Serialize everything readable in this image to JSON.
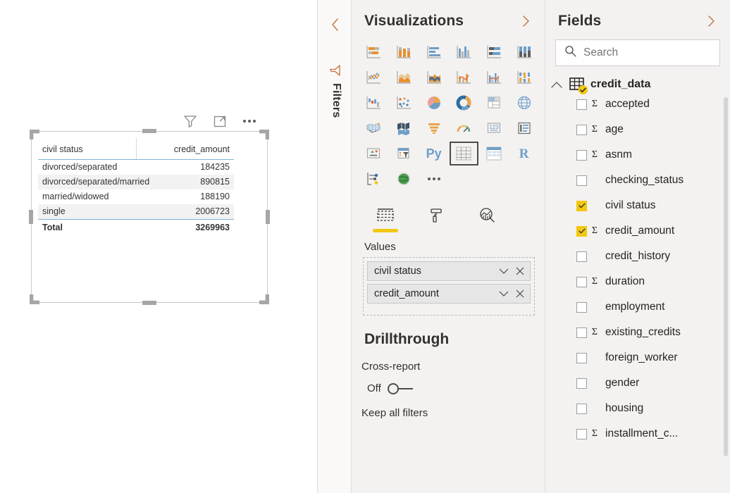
{
  "canvas": {
    "toolbar": [
      {
        "name": "filter-icon",
        "label": "Filters"
      },
      {
        "name": "focus-mode-icon",
        "label": "Focus mode"
      },
      {
        "name": "more-options-icon",
        "label": "More options"
      }
    ],
    "table_visual": {
      "columns": [
        "civil status",
        "credit_amount"
      ],
      "rows": [
        {
          "civil_status": "divorced/separated",
          "credit_amount": "184235"
        },
        {
          "civil_status": "divorced/separated/married",
          "credit_amount": "890815"
        },
        {
          "civil_status": "married/widowed",
          "credit_amount": "188190"
        },
        {
          "civil_status": "single",
          "credit_amount": "2006723"
        }
      ],
      "total_label": "Total",
      "total_value": "3269963"
    }
  },
  "filters_rail": {
    "collapse_label": "<",
    "title": "Filters",
    "icon": "filter-icon"
  },
  "visualizations": {
    "title": "Visualizations",
    "expand_label": ">",
    "collapse_label": "<",
    "viz_types": [
      {
        "name": "stacked-bar-chart",
        "selected": false
      },
      {
        "name": "stacked-column-chart",
        "selected": false
      },
      {
        "name": "clustered-bar-chart",
        "selected": false
      },
      {
        "name": "clustered-column-chart",
        "selected": false
      },
      {
        "name": "100-percent-stacked-bar-chart",
        "selected": false
      },
      {
        "name": "100-percent-stacked-column-chart",
        "selected": false
      },
      {
        "name": "line-chart",
        "selected": false
      },
      {
        "name": "area-chart",
        "selected": false
      },
      {
        "name": "stacked-area-chart",
        "selected": false
      },
      {
        "name": "line-and-stacked-column-chart",
        "selected": false
      },
      {
        "name": "line-and-clustered-column-chart",
        "selected": false
      },
      {
        "name": "ribbon-chart",
        "selected": false
      },
      {
        "name": "waterfall-chart",
        "selected": false
      },
      {
        "name": "scatter-chart",
        "selected": false
      },
      {
        "name": "pie-chart",
        "selected": false
      },
      {
        "name": "donut-chart",
        "selected": false
      },
      {
        "name": "treemap",
        "selected": false
      },
      {
        "name": "map",
        "selected": false
      },
      {
        "name": "filled-map",
        "selected": false
      },
      {
        "name": "shape-map",
        "selected": false
      },
      {
        "name": "funnel-chart",
        "selected": false
      },
      {
        "name": "gauge-chart",
        "selected": false
      },
      {
        "name": "card",
        "selected": false
      },
      {
        "name": "multi-row-card",
        "selected": false
      },
      {
        "name": "kpi",
        "selected": false
      },
      {
        "name": "slicer",
        "selected": false
      },
      {
        "name": "python-visual",
        "selected": false,
        "glyph": "Py"
      },
      {
        "name": "table",
        "selected": true
      },
      {
        "name": "matrix",
        "selected": false
      },
      {
        "name": "r-script-visual",
        "selected": false,
        "glyph": "R"
      },
      {
        "name": "key-influencers",
        "selected": false
      },
      {
        "name": "arcgis-map",
        "selected": false
      },
      {
        "name": "get-more-visuals",
        "selected": false
      }
    ],
    "field_tabs": [
      {
        "name": "tab-fields",
        "active": true
      },
      {
        "name": "tab-format",
        "active": false
      },
      {
        "name": "tab-analytics",
        "active": false
      }
    ],
    "values_well": {
      "label": "Values",
      "chips": [
        {
          "label": "civil status"
        },
        {
          "label": "credit_amount"
        }
      ]
    },
    "drillthrough": {
      "title": "Drillthrough",
      "cross_report_label": "Cross-report",
      "cross_report_state": "Off",
      "keep_all_filters_label": "Keep all filters"
    }
  },
  "fields": {
    "title": "Fields",
    "expand_label": ">",
    "search": {
      "placeholder": "Search",
      "value": "",
      "icon": "search-icon"
    },
    "table_node": {
      "label": "credit_data",
      "expanded": true,
      "checked": true
    },
    "items": [
      {
        "label": "accepted",
        "checked": false,
        "measure": true
      },
      {
        "label": "age",
        "checked": false,
        "measure": true
      },
      {
        "label": "asnm",
        "checked": false,
        "measure": true
      },
      {
        "label": "checking_status",
        "checked": false,
        "measure": false
      },
      {
        "label": "civil status",
        "checked": true,
        "measure": false
      },
      {
        "label": "credit_amount",
        "checked": true,
        "measure": true
      },
      {
        "label": "credit_history",
        "checked": false,
        "measure": false
      },
      {
        "label": "duration",
        "checked": false,
        "measure": true
      },
      {
        "label": "employment",
        "checked": false,
        "measure": false
      },
      {
        "label": "existing_credits",
        "checked": false,
        "measure": true
      },
      {
        "label": "foreign_worker",
        "checked": false,
        "measure": false
      },
      {
        "label": "gender",
        "checked": false,
        "measure": false
      },
      {
        "label": "housing",
        "checked": false,
        "measure": false
      },
      {
        "label": "installment_c...",
        "checked": false,
        "measure": true
      }
    ]
  },
  "colors": {
    "accent_yellow": "#F2C811",
    "panel_bg": "#F3F2F1",
    "canvas_bg": "#FFFFFF",
    "text": "#252423",
    "table_rule_blue": "#7FB3D9",
    "viz_icon_blue": "#6F9EC9",
    "viz_icon_orange": "#E8912D"
  }
}
